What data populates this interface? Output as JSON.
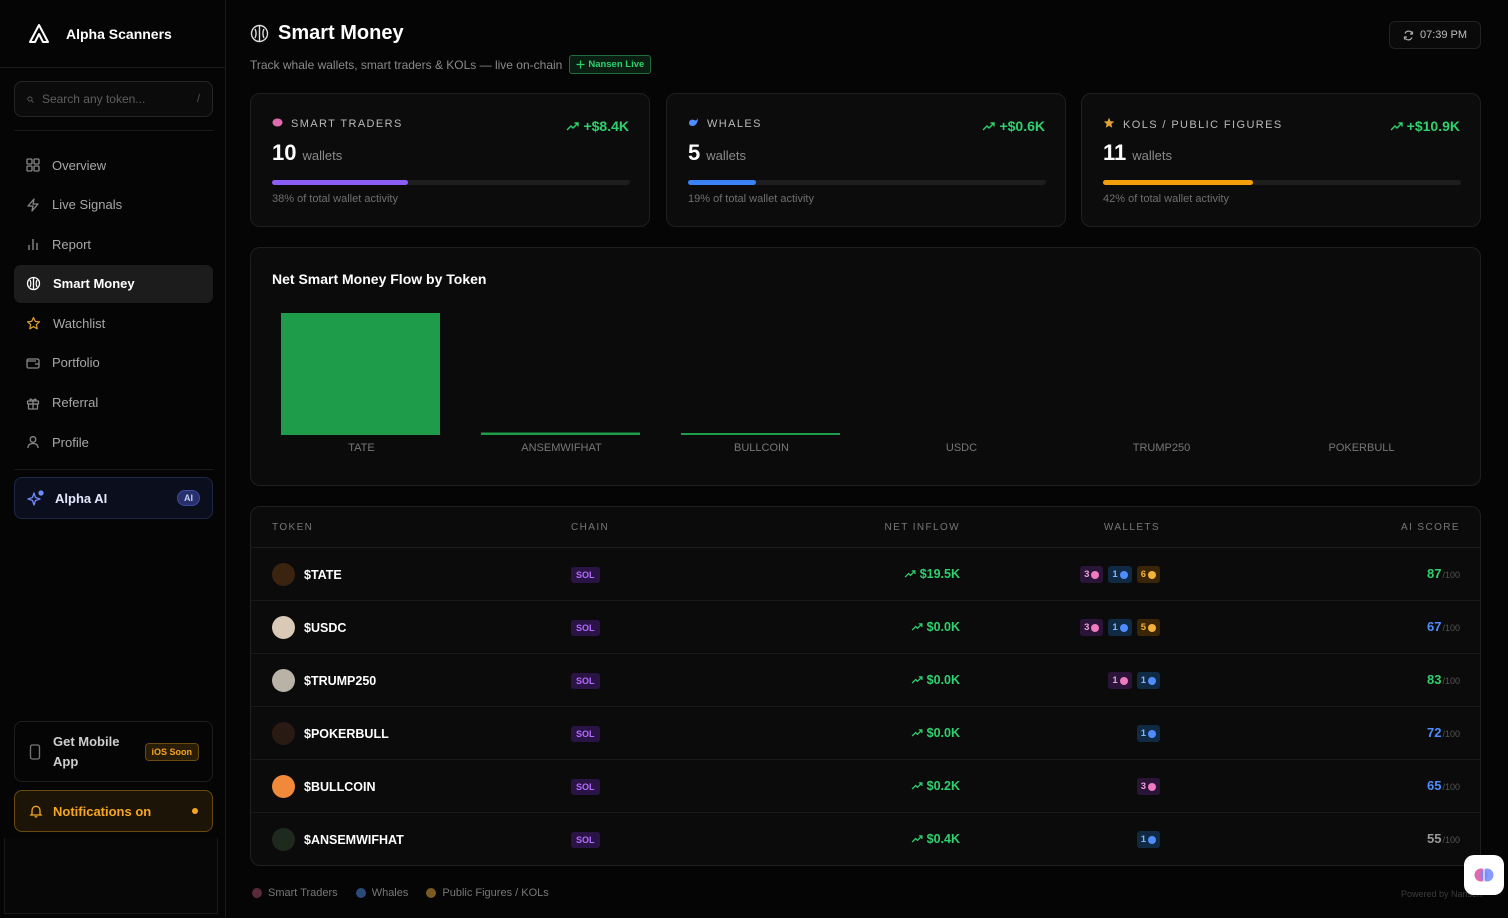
{
  "app": {
    "name": "Alpha Scanners"
  },
  "search": {
    "placeholder": "Search any token...",
    "shortcut": "/"
  },
  "nav": [
    {
      "label": "Overview",
      "icon": "grid-icon"
    },
    {
      "label": "Live Signals",
      "icon": "bolt-icon"
    },
    {
      "label": "Report",
      "icon": "bar-chart-icon"
    },
    {
      "label": "Smart Money",
      "icon": "brain-icon",
      "active": true
    },
    {
      "label": "Watchlist",
      "icon": "star-icon"
    },
    {
      "label": "Portfolio",
      "icon": "wallet-icon"
    },
    {
      "label": "Referral",
      "icon": "gift-icon"
    },
    {
      "label": "Profile",
      "icon": "user-icon"
    }
  ],
  "alpha_ai": {
    "label": "Alpha AI",
    "badge": "AI"
  },
  "mobile": {
    "label": "Get Mobile App",
    "badge": "iOS Soon"
  },
  "notifications": {
    "label": "Notifications on"
  },
  "header": {
    "title": "Smart Money",
    "subtitle": "Track whale wallets, smart traders & KOLs — live on-chain",
    "live_badge": "Nansen Live",
    "time": "07:39 PM"
  },
  "cards": [
    {
      "label": "SMART TRADERS",
      "flow": "+$8.4K",
      "count": "10",
      "unit": "wallets",
      "share": 0.38,
      "share_text": "38% of total wallet activity",
      "color": "#8b5cf6"
    },
    {
      "label": "WHALES",
      "flow": "+$0.6K",
      "count": "5",
      "unit": "wallets",
      "share": 0.19,
      "share_text": "19% of total wallet activity",
      "color": "#3b82f6"
    },
    {
      "label": "KOLS / PUBLIC FIGURES",
      "flow": "+$10.9K",
      "count": "11",
      "unit": "wallets",
      "share": 0.42,
      "share_text": "42% of total wallet activity",
      "color": "#f59e0b"
    }
  ],
  "chart_data": {
    "type": "bar",
    "title": "Net Smart Money Flow by Token",
    "categories": [
      "TATE",
      "ANSEMWIFHAT",
      "BULLCOIN",
      "USDC",
      "TRUMP250",
      "POKERBULL"
    ],
    "values": [
      19.5,
      0.4,
      0.2,
      0.0,
      0.0,
      0.0
    ],
    "ylim": [
      0,
      19.5
    ],
    "grid": false,
    "color": "#1e9c4a"
  },
  "table": {
    "headers": {
      "token": "TOKEN",
      "chain": "CHAIN",
      "inflow": "NET INFLOW",
      "wallets": "WALLETS",
      "score": "AI SCORE"
    },
    "score_suffix": "/100",
    "rows": [
      {
        "token": "$TATE",
        "chain": "SOL",
        "inflow": "$19.5K",
        "smart": "3",
        "whale": "1",
        "kol": "6",
        "score": "87",
        "score_color": "#2fd06e",
        "avatar": "#3a2410"
      },
      {
        "token": "$USDC",
        "chain": "SOL",
        "inflow": "$0.0K",
        "smart": "3",
        "whale": "1",
        "kol": "5",
        "score": "67",
        "score_color": "#4f8dff",
        "avatar": "#d9c9b6"
      },
      {
        "token": "$TRUMP250",
        "chain": "SOL",
        "inflow": "$0.0K",
        "smart": "1",
        "whale": "1",
        "kol": "",
        "score": "83",
        "score_color": "#2fd06e",
        "avatar": "#b9b2a6"
      },
      {
        "token": "$POKERBULL",
        "chain": "SOL",
        "inflow": "$0.0K",
        "smart": "",
        "whale": "1",
        "kol": "",
        "score": "72",
        "score_color": "#4f8dff",
        "avatar": "#2a1a14"
      },
      {
        "token": "$BULLCOIN",
        "chain": "SOL",
        "inflow": "$0.2K",
        "smart": "3",
        "whale": "",
        "kol": "",
        "score": "65",
        "score_color": "#4f8dff",
        "avatar": "#f08a3a"
      },
      {
        "token": "$ANSEMWIFHAT",
        "chain": "SOL",
        "inflow": "$0.4K",
        "smart": "",
        "whale": "1",
        "kol": "",
        "score": "55",
        "score_color": "#9a9a9a",
        "avatar": "#1e2a1e"
      }
    ]
  },
  "legend": [
    "Smart Traders",
    "Whales",
    "Public Figures / KOLs"
  ],
  "powered": "Powered by Nansen"
}
